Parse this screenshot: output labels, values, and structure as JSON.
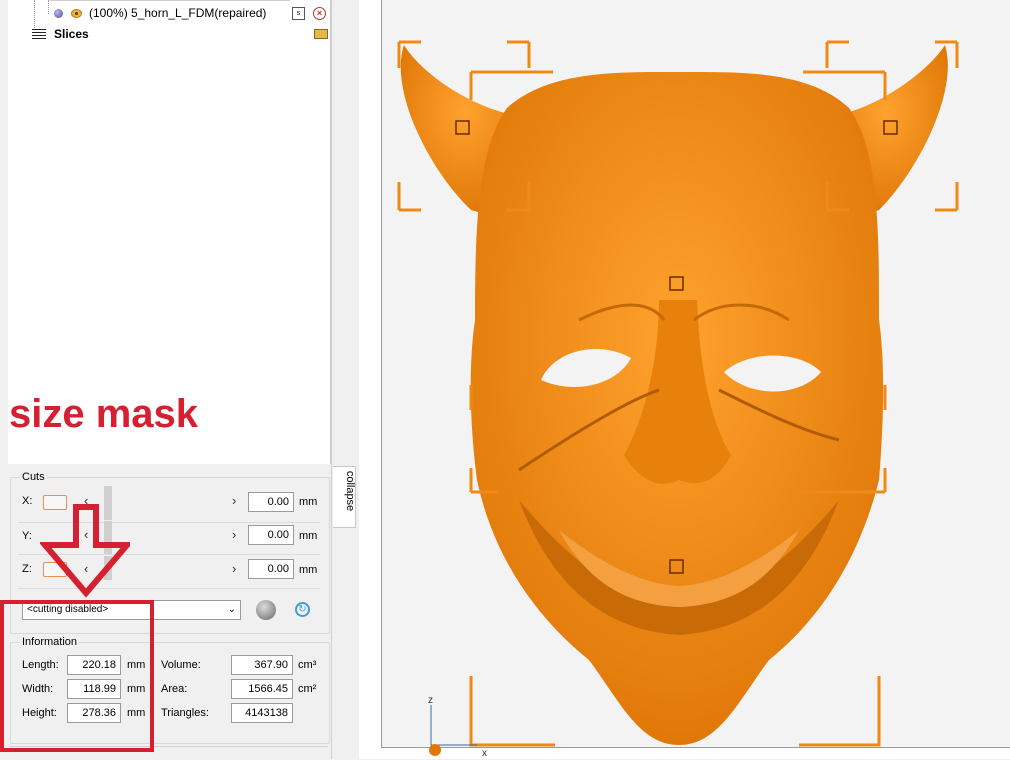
{
  "tree": {
    "mesh_item": "(100%) 5_horn_L_FDM(repaired)",
    "mesh_btn": "s",
    "slices_label": "Slices"
  },
  "annotation": {
    "size_label": "size mask"
  },
  "collapse_label": "collapse",
  "cuts": {
    "title": "Cuts",
    "rows": [
      {
        "axis": "X:",
        "value": "0.00",
        "unit": "mm"
      },
      {
        "axis": "Y:",
        "value": "0.00",
        "unit": "mm"
      },
      {
        "axis": "Z:",
        "value": "0.00",
        "unit": "mm"
      }
    ],
    "mode_select": "<cutting disabled>"
  },
  "information": {
    "title": "Information",
    "length_label": "Length:",
    "length": "220.18",
    "length_unit": "mm",
    "width_label": "Width:",
    "width": "118.99",
    "width_unit": "mm",
    "height_label": "Height:",
    "height": "278.36",
    "height_unit": "mm",
    "volume_label": "Volume:",
    "volume": "367.90",
    "volume_unit": "cm³",
    "area_label": "Area:",
    "area": "1566.45",
    "area_unit": "cm²",
    "triangles_label": "Triangles:",
    "triangles": "4143138"
  },
  "axes": {
    "z": "z",
    "x": "x"
  },
  "colors": {
    "model": "#f08a16",
    "accent": "#d42030",
    "bbox": "#f08a16"
  }
}
